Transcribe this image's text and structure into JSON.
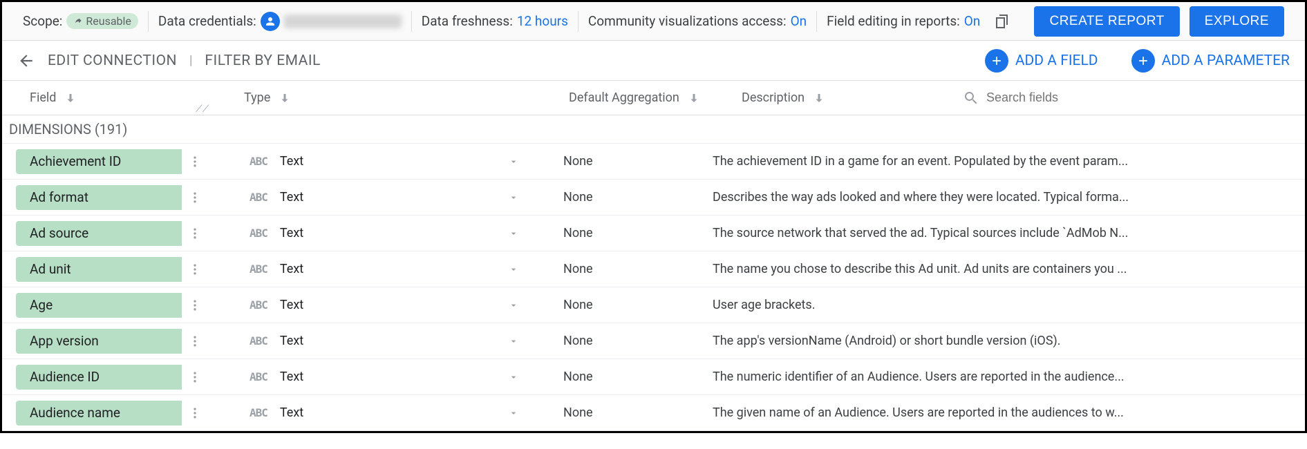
{
  "topbar": {
    "scope_label": "Scope:",
    "scope_badge": "Reusable",
    "credentials_label": "Data credentials:",
    "freshness_label": "Data freshness:",
    "freshness_value": "12 hours",
    "community_label": "Community visualizations access:",
    "community_value": "On",
    "field_editing_label": "Field editing in reports:",
    "field_editing_value": "On",
    "create_report": "CREATE REPORT",
    "explore": "EXPLORE"
  },
  "toolbar2": {
    "edit_connection": "EDIT CONNECTION",
    "filter_by_email": "FILTER BY EMAIL",
    "add_field": "ADD A FIELD",
    "add_parameter": "ADD A PARAMETER"
  },
  "columns": {
    "field": "Field",
    "type": "Type",
    "aggregation": "Default Aggregation",
    "description": "Description",
    "search_placeholder": "Search fields"
  },
  "section_header": "DIMENSIONS (191)",
  "type_badge": "ABC",
  "rows": [
    {
      "name": "Achievement ID",
      "type": "Text",
      "agg": "None",
      "desc": "The achievement ID in a game for an event. Populated by the event param..."
    },
    {
      "name": "Ad format",
      "type": "Text",
      "agg": "None",
      "desc": "Describes the way ads looked and where they were located. Typical forma..."
    },
    {
      "name": "Ad source",
      "type": "Text",
      "agg": "None",
      "desc": "The source network that served the ad. Typical sources include `AdMob N..."
    },
    {
      "name": "Ad unit",
      "type": "Text",
      "agg": "None",
      "desc": "The name you chose to describe this Ad unit. Ad units are containers you ..."
    },
    {
      "name": "Age",
      "type": "Text",
      "agg": "None",
      "desc": "User age brackets."
    },
    {
      "name": "App version",
      "type": "Text",
      "agg": "None",
      "desc": "The app's versionName (Android) or short bundle version (iOS)."
    },
    {
      "name": "Audience ID",
      "type": "Text",
      "agg": "None",
      "desc": "The numeric identifier of an Audience. Users are reported in the audience..."
    },
    {
      "name": "Audience name",
      "type": "Text",
      "agg": "None",
      "desc": "The given name of an Audience. Users are reported in the audiences to w..."
    }
  ]
}
